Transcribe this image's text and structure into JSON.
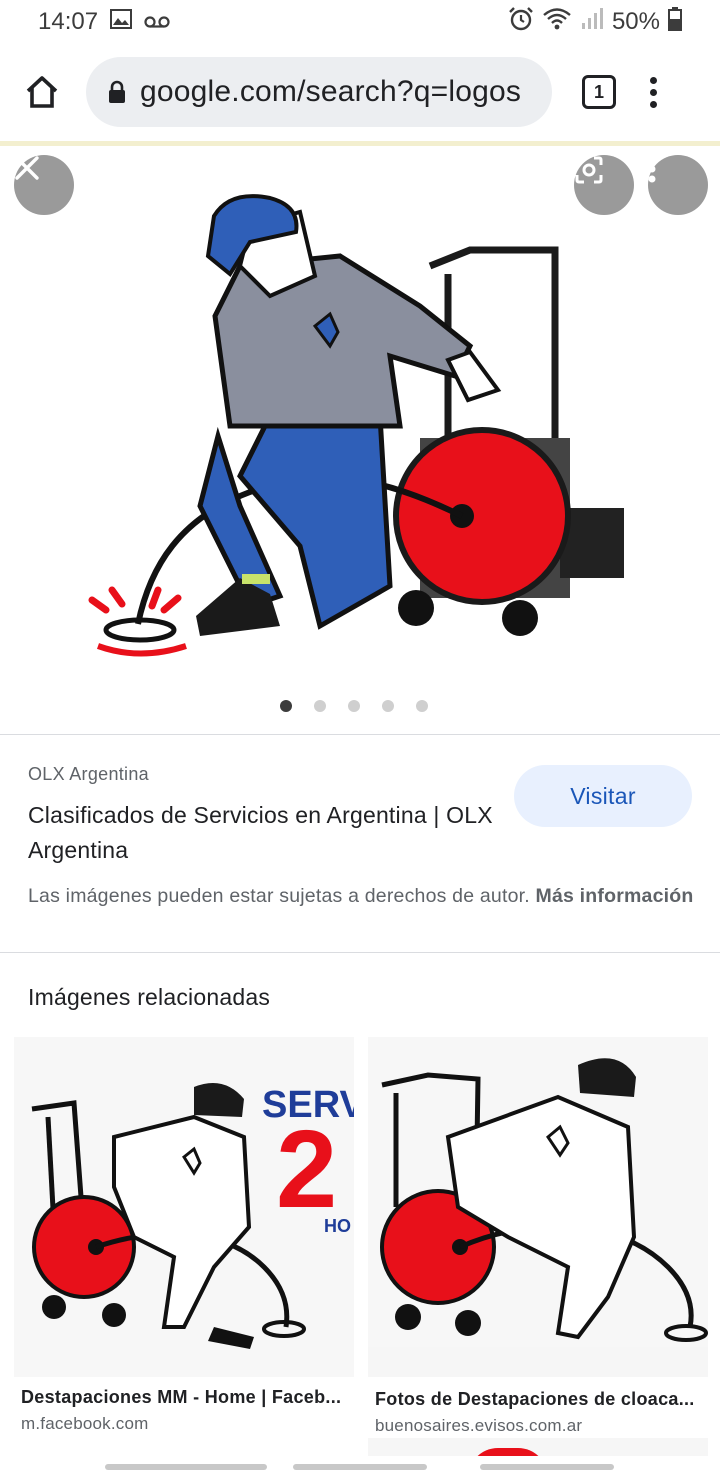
{
  "status_bar": {
    "time": "14:07",
    "battery": "50%",
    "icons": [
      "image-icon",
      "voicemail-icon",
      "alarm-icon",
      "wifi-icon",
      "signal-icon",
      "battery-icon"
    ]
  },
  "toolbar": {
    "url": "google.com/search?q=logos",
    "tab_count": "1",
    "icons": [
      "home-icon",
      "lock-icon",
      "tab-switcher-icon",
      "more-vert-icon"
    ]
  },
  "image_viewer": {
    "close_icon": "close-icon",
    "lens_icon": "lens-icon",
    "more_icon": "more-vert-icon",
    "dots_count": 5,
    "active_dot": 0
  },
  "result": {
    "source": "OLX Argentina",
    "title": "Clasificados de Servicios en Argentina | OLX Argentina",
    "visit_label": "Visitar",
    "copyright_text": "Las imágenes pueden estar sujetas a derechos de autor.",
    "more_info_label": "Más información"
  },
  "related": {
    "heading": "Imágenes relacionadas",
    "items": [
      {
        "title": "Destapaciones MM - Home | Faceb...",
        "url": "m.facebook.com",
        "overlay_text": "SERV",
        "overlay_digit": "2",
        "overlay_small": "HO"
      },
      {
        "title": "Fotos de Destapaciones de cloaca...",
        "url": "buenosaires.evisos.com.ar"
      }
    ]
  },
  "colors": {
    "accent_red": "#e8101a",
    "uniform_blue": "#2f5fb8",
    "shirt_gray": "#8a8f9e",
    "visit_bg": "#e8f0fe",
    "visit_text": "#1a56b8"
  }
}
